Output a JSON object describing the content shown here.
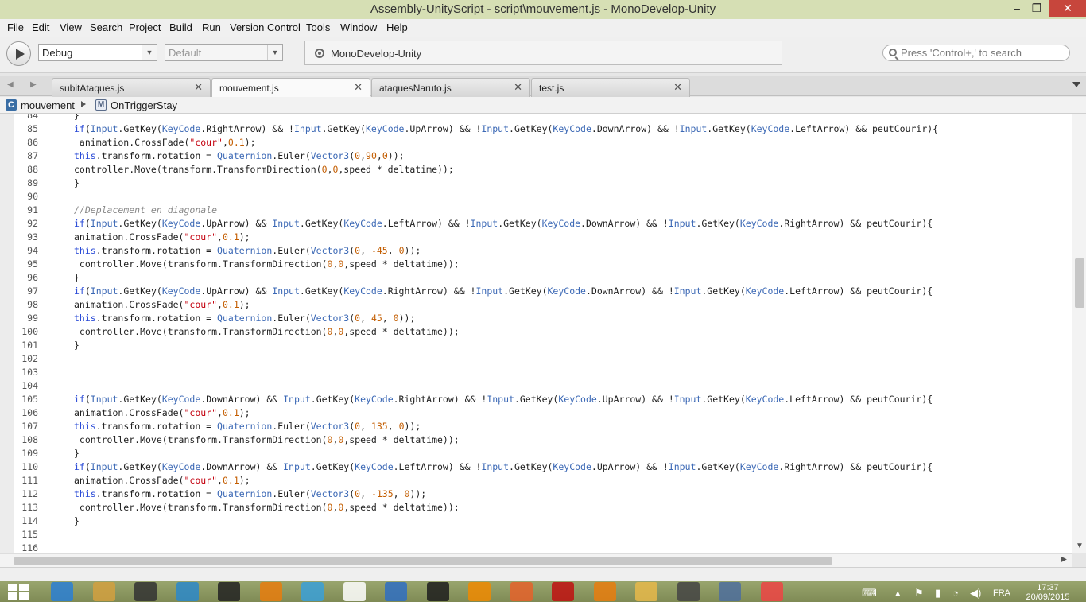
{
  "window": {
    "title": "Assembly-UnityScript - script\\mouvement.js - MonoDevelop-Unity",
    "minimize": "–",
    "maximize": "❐",
    "close": "✕"
  },
  "menu": [
    "File",
    "Edit",
    "View",
    "Search",
    "Project",
    "Build",
    "Run",
    "Version Control",
    "Tools",
    "Window",
    "Help"
  ],
  "toolbar": {
    "configuration": "Debug",
    "target": "Default",
    "status_text": "MonoDevelop-Unity",
    "search_placeholder": "Press 'Control+,' to search"
  },
  "tabs": [
    {
      "label": "subitAtaques.js",
      "active": false
    },
    {
      "label": "mouvement.js",
      "active": true
    },
    {
      "label": "ataquesNaruto.js",
      "active": false
    },
    {
      "label": "test.js",
      "active": false
    }
  ],
  "breadcrumb": {
    "class_icon": "C",
    "class_name": "mouvement",
    "method_icon": "M",
    "method_name": "OnTriggerStay"
  },
  "editor": {
    "lines": [
      {
        "n": "84",
        "text": "}"
      },
      {
        "n": "85",
        "text": "if(Input.GetKey(KeyCode.RightArrow) && !Input.GetKey(KeyCode.UpArrow) && !Input.GetKey(KeyCode.DownArrow) && !Input.GetKey(KeyCode.LeftArrow) && peutCourir){"
      },
      {
        "n": "86",
        "text": " animation.CrossFade(\"cour\",0.1);"
      },
      {
        "n": "87",
        "text": "this.transform.rotation = Quaternion.Euler(Vector3(0,90,0));"
      },
      {
        "n": "88",
        "text": "controller.Move(transform.TransformDirection(0,0,speed * deltatime));"
      },
      {
        "n": "89",
        "text": "}"
      },
      {
        "n": "90",
        "text": ""
      },
      {
        "n": "91",
        "text": "//Deplacement en diagonale"
      },
      {
        "n": "92",
        "text": "if(Input.GetKey(KeyCode.UpArrow) && Input.GetKey(KeyCode.LeftArrow) && !Input.GetKey(KeyCode.DownArrow) && !Input.GetKey(KeyCode.RightArrow) && peutCourir){"
      },
      {
        "n": "93",
        "text": "animation.CrossFade(\"cour\",0.1);"
      },
      {
        "n": "94",
        "text": "this.transform.rotation = Quaternion.Euler(Vector3(0, -45, 0));"
      },
      {
        "n": "95",
        "text": " controller.Move(transform.TransformDirection(0,0,speed * deltatime));"
      },
      {
        "n": "96",
        "text": "}"
      },
      {
        "n": "97",
        "text": "if(Input.GetKey(KeyCode.UpArrow) && Input.GetKey(KeyCode.RightArrow) && !Input.GetKey(KeyCode.DownArrow) && !Input.GetKey(KeyCode.LeftArrow) && peutCourir){"
      },
      {
        "n": "98",
        "text": "animation.CrossFade(\"cour\",0.1);"
      },
      {
        "n": "99",
        "text": "this.transform.rotation = Quaternion.Euler(Vector3(0, 45, 0));"
      },
      {
        "n": "100",
        "text": " controller.Move(transform.TransformDirection(0,0,speed * deltatime));"
      },
      {
        "n": "101",
        "text": "}"
      },
      {
        "n": "102",
        "text": ""
      },
      {
        "n": "103",
        "text": ""
      },
      {
        "n": "104",
        "text": ""
      },
      {
        "n": "105",
        "text": "if(Input.GetKey(KeyCode.DownArrow) && Input.GetKey(KeyCode.RightArrow) && !Input.GetKey(KeyCode.UpArrow) && !Input.GetKey(KeyCode.LeftArrow) && peutCourir){"
      },
      {
        "n": "106",
        "text": "animation.CrossFade(\"cour\",0.1);"
      },
      {
        "n": "107",
        "text": "this.transform.rotation = Quaternion.Euler(Vector3(0, 135, 0));"
      },
      {
        "n": "108",
        "text": " controller.Move(transform.TransformDirection(0,0,speed * deltatime));"
      },
      {
        "n": "109",
        "text": "}"
      },
      {
        "n": "110",
        "text": "if(Input.GetKey(KeyCode.DownArrow) && Input.GetKey(KeyCode.LeftArrow) && !Input.GetKey(KeyCode.UpArrow) && !Input.GetKey(KeyCode.RightArrow) && peutCourir){"
      },
      {
        "n": "111",
        "text": "animation.CrossFade(\"cour\",0.1);"
      },
      {
        "n": "112",
        "text": "this.transform.rotation = Quaternion.Euler(Vector3(0, -135, 0));"
      },
      {
        "n": "113",
        "text": " controller.Move(transform.TransformDirection(0,0,speed * deltatime));"
      },
      {
        "n": "114",
        "text": "}"
      },
      {
        "n": "115",
        "text": ""
      },
      {
        "n": "116",
        "text": ""
      }
    ]
  },
  "taskbar": {
    "language": "FRA",
    "time": "17:37",
    "date": "20/09/2015",
    "apps": [
      "internet-explorer-icon",
      "media-player-icon",
      "speaker-app-icon",
      "touch-app-icon",
      "amazon-icon",
      "blender-icon",
      "store-icon",
      "home-icon",
      "safari-icon",
      "h-app-icon",
      "vlc-icon",
      "firefox-icon",
      "record-icon",
      "blender-icon-2",
      "file-explorer-icon",
      "unity-icon",
      "monodevelop-icon",
      "ball-app-icon"
    ]
  },
  "colors": {
    "titlebar": "#d6dfb4",
    "keyword": "#2a4bd7",
    "type": "#3b68b5",
    "number": "#c35d00",
    "string": "#c3000e",
    "comment": "#888888"
  }
}
